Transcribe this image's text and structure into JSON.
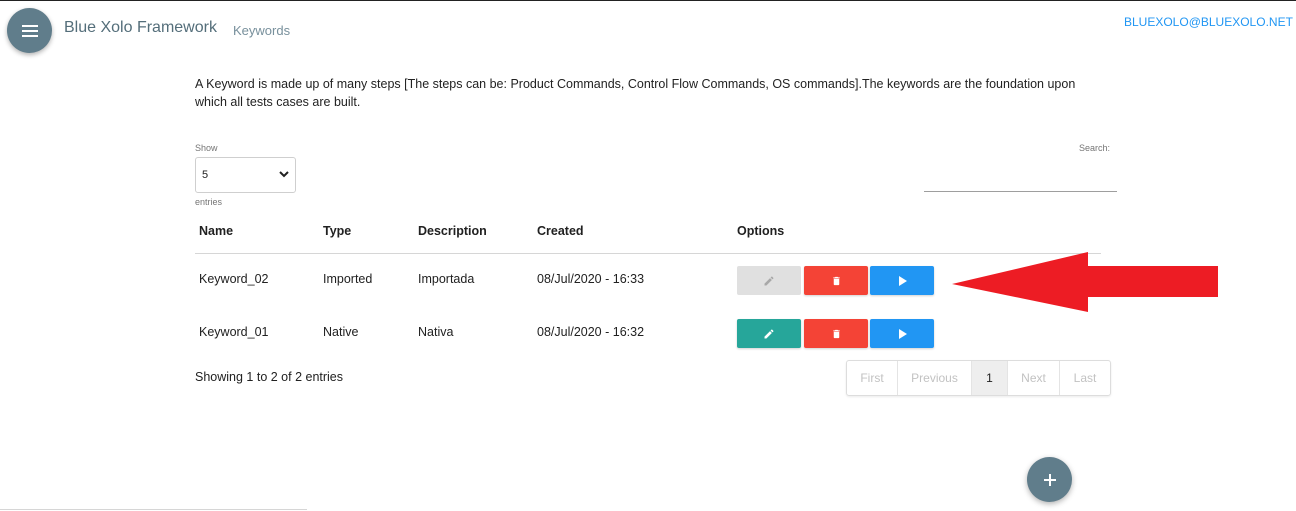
{
  "header": {
    "brand": "Blue Xolo Framework",
    "breadcrumb": "Keywords",
    "user_email": "BLUEXOLO@BLUEXOLO.NET"
  },
  "intro_text": "A Keyword is made up of many steps [The steps can be: Product Commands, Control Flow Commands, OS commands].The keywords are the foundation upon which all tests cases are built.",
  "table_controls": {
    "show_label": "Show",
    "page_length": "5",
    "entries_label": "entries",
    "search_label": "Search:",
    "search_value": ""
  },
  "table": {
    "columns": [
      "Name",
      "Type",
      "Description",
      "Created",
      "Options"
    ],
    "rows": [
      {
        "name": "Keyword_02",
        "type": "Imported",
        "description": "Importada",
        "created": "08/Jul/2020 - 16:33",
        "edit_enabled": false
      },
      {
        "name": "Keyword_01",
        "type": "Native",
        "description": "Nativa",
        "created": "08/Jul/2020 - 16:32",
        "edit_enabled": true
      }
    ]
  },
  "footer": {
    "info": "Showing 1 to 2 of 2 entries",
    "pagination": {
      "first": "First",
      "previous": "Previous",
      "current": "1",
      "next": "Next",
      "last": "Last"
    }
  },
  "icons": {
    "menu": "menu-icon",
    "edit": "pencil-icon",
    "delete": "trash-icon",
    "run": "play-icon",
    "add": "plus-icon",
    "select": "chevron-down-icon",
    "annotation": "red-arrow-icon"
  },
  "colors": {
    "primary": "#607d8b",
    "edit": "#26a69a",
    "edit_disabled": "#e0e0e0",
    "delete": "#f44336",
    "run": "#2196f3",
    "link": "#2196f3",
    "annotation_arrow": "#ed1c24"
  }
}
